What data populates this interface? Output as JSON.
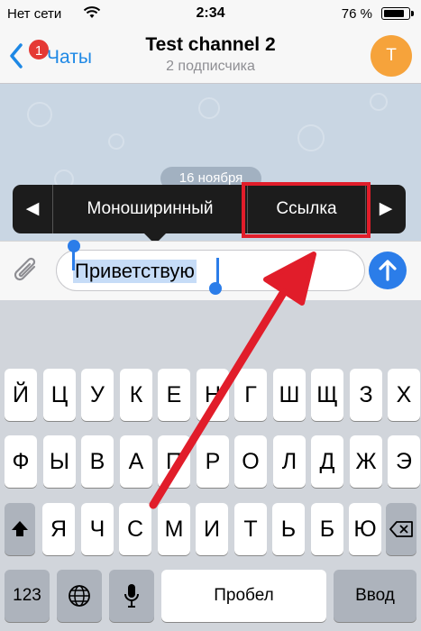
{
  "status_bar": {
    "carrier": "Нет сети",
    "time": "2:34",
    "battery": "76 %",
    "battery_level": 0.76
  },
  "nav": {
    "back_label": "Чаты",
    "unread_badge": "1",
    "title": "Test channel 2",
    "subtitle": "2 подписчика",
    "avatar_letter": "T",
    "avatar_color": "#f6a33b"
  },
  "chat": {
    "date_pill": "16 ноября"
  },
  "edit_menu": {
    "prev_icon": "◀",
    "items": [
      "Моноширинный",
      "Ссылка"
    ],
    "next_icon": "▶"
  },
  "input": {
    "value": "Приветствую"
  },
  "keyboard": {
    "row1": [
      "Й",
      "Ц",
      "У",
      "К",
      "Е",
      "Н",
      "Г",
      "Ш",
      "Щ",
      "З",
      "Х"
    ],
    "row2": [
      "Ф",
      "Ы",
      "В",
      "А",
      "П",
      "Р",
      "О",
      "Л",
      "Д",
      "Ж",
      "Э"
    ],
    "row3": [
      "Я",
      "Ч",
      "С",
      "М",
      "И",
      "Т",
      "Ь",
      "Б",
      "Ю"
    ],
    "numbers_key": "123",
    "space_key": "Пробел",
    "return_key": "Ввод"
  },
  "colors": {
    "accent": "#2b7de9",
    "highlight": "#e11d2a",
    "badge": "#e53935"
  }
}
